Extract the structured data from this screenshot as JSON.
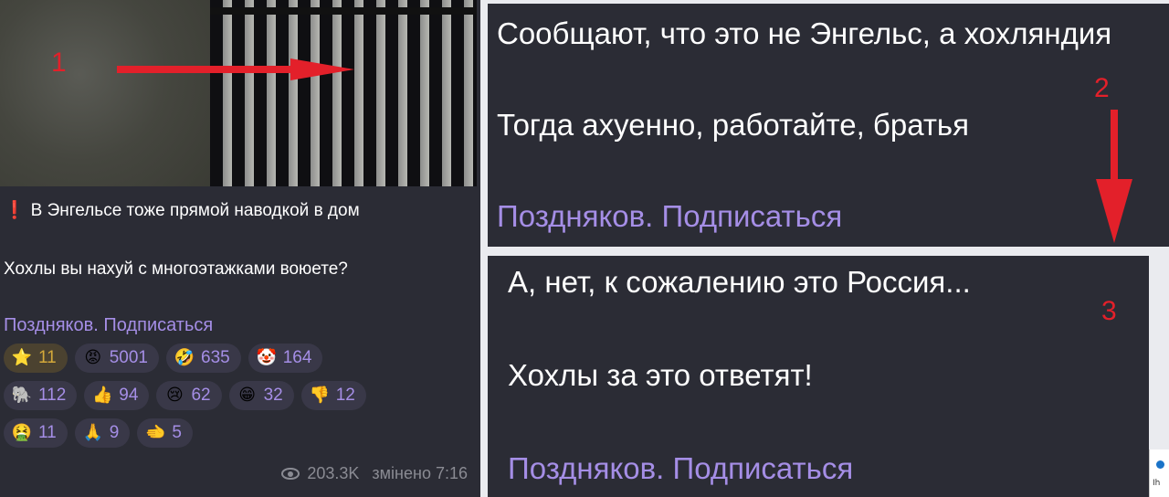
{
  "left_post": {
    "text_line1": "В Энгельсе тоже прямой наводкой в дом",
    "text_line2": "Хохлы вы нахуй с многоэтажками воюете?",
    "link": "Поздняков. Подписаться",
    "reactions": [
      {
        "icon": "star-icon",
        "glyph": "⭐",
        "count": "11"
      },
      {
        "icon": "angry-face-icon",
        "glyph": "😡",
        "count": "5001"
      },
      {
        "icon": "rofl-face-icon",
        "glyph": "🤣",
        "count": "635"
      },
      {
        "icon": "clown-face-icon",
        "glyph": "🤡",
        "count": "164"
      },
      {
        "icon": "elephant-icon",
        "glyph": "🐘",
        "count": "112"
      },
      {
        "icon": "thumbs-up-icon",
        "glyph": "👍",
        "count": "94"
      },
      {
        "icon": "crying-face-icon",
        "glyph": "😢",
        "count": "62"
      },
      {
        "icon": "grinning-face-icon",
        "glyph": "😁",
        "count": "32"
      },
      {
        "icon": "thumbs-down-icon",
        "glyph": "👎",
        "count": "12"
      },
      {
        "icon": "nauseated-face-icon",
        "glyph": "🤮",
        "count": "11"
      },
      {
        "icon": "praying-hands-icon",
        "glyph": "🙏",
        "count": "9"
      },
      {
        "icon": "pointing-hand-icon",
        "glyph": "🫲",
        "count": "5"
      }
    ],
    "views": "203.3K",
    "edited": "змінено 7:16"
  },
  "right_top": {
    "line1": "Сообщают, что это не Энгельс, а хохляндия",
    "line2": "Тогда ахуенно, работайте, братья",
    "link": "Поздняков. Подписаться"
  },
  "right_bottom": {
    "line1": "А, нет, к сожалению это Россия...",
    "line2": "Хохлы за это ответят!",
    "link": "Поздняков. Подписаться"
  },
  "annotations": {
    "n1": "1",
    "n2": "2",
    "n3": "3",
    "color": "#e3202a"
  },
  "corner": {
    "label": "Ih"
  }
}
